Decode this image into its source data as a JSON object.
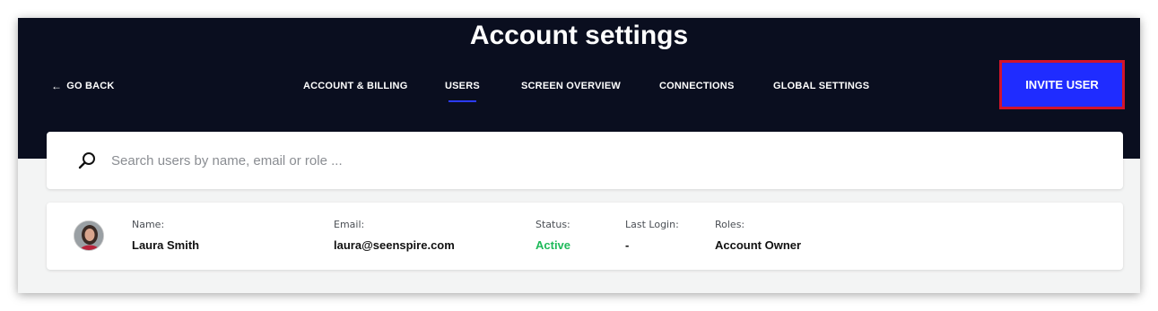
{
  "header": {
    "title": "Account settings",
    "go_back": "GO BACK",
    "invite_button": "INVITE USER"
  },
  "tabs": [
    {
      "label": "ACCOUNT & BILLING",
      "active": false
    },
    {
      "label": "USERS",
      "active": true
    },
    {
      "label": "SCREEN OVERVIEW",
      "active": false
    },
    {
      "label": "CONNECTIONS",
      "active": false
    },
    {
      "label": "GLOBAL SETTINGS",
      "active": false
    }
  ],
  "search": {
    "placeholder": "Search users by name, email or role ...",
    "value": ""
  },
  "users": [
    {
      "name_label": "Name:",
      "name": "Laura Smith",
      "email_label": "Email:",
      "email": "laura@seenspire.com",
      "status_label": "Status:",
      "status": "Active",
      "last_login_label": "Last Login:",
      "last_login": "-",
      "roles_label": "Roles:",
      "roles": "Account Owner"
    }
  ],
  "colors": {
    "header_bg": "#0a0e1f",
    "accent": "#1f2cff",
    "highlight_border": "#d2142a",
    "status_active": "#1fba5a"
  },
  "icons": {
    "back": "arrow-left-icon",
    "search": "search-icon",
    "avatar": "user-avatar"
  }
}
